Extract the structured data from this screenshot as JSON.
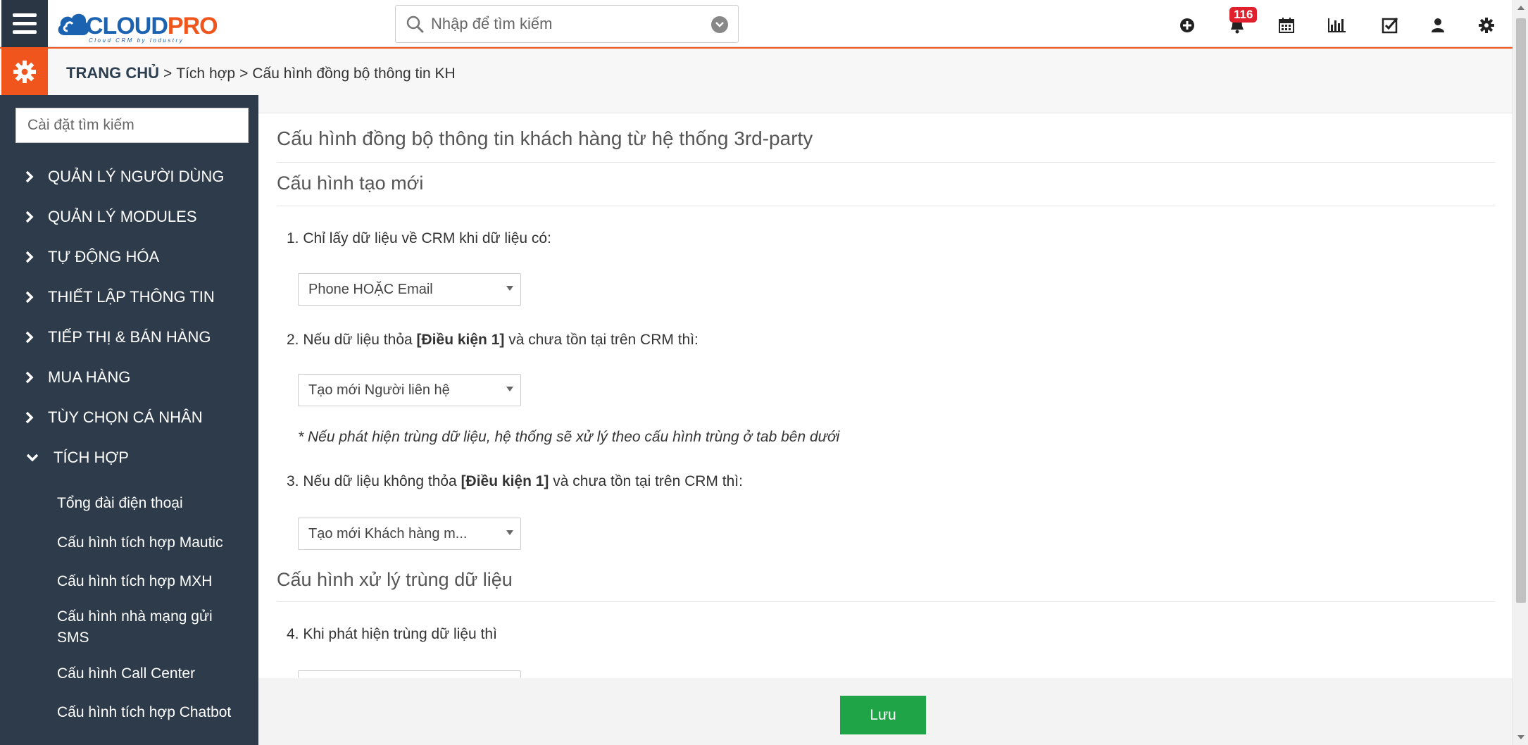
{
  "brand": {
    "logo_left": "CLOUD",
    "logo_right": "PRO",
    "tagline": "Cloud CRM by Industry",
    "accent": "#f0551e",
    "blue": "#1b62b0",
    "sidebar_bg": "#2d3b4a",
    "save_green": "#1fa447"
  },
  "search": {
    "placeholder": "Nhập để tìm kiếm"
  },
  "notifications": {
    "count": "116"
  },
  "top_icons": [
    "plus-circle-icon",
    "bell-icon",
    "calendar-icon",
    "bar-chart-icon",
    "checkbox-icon",
    "user-icon",
    "gear-icon"
  ],
  "breadcrumb": {
    "home": "TRANG CHỦ",
    "sep": ">",
    "level1": "Tích hợp",
    "level2": "Cấu hình đồng bộ thông tin KH"
  },
  "sidebar": {
    "search_placeholder": "Cài đặt tìm kiếm",
    "items": [
      {
        "label": "QUẢN LÝ NGƯỜI DÙNG"
      },
      {
        "label": "QUẢN LÝ MODULES"
      },
      {
        "label": "TỰ ĐỘNG HÓA"
      },
      {
        "label": "THIẾT LẬP THÔNG TIN"
      },
      {
        "label": "TIẾP THỊ & BÁN HÀNG"
      },
      {
        "label": "MUA HÀNG"
      },
      {
        "label": "TÙY CHỌN CÁ NHÂN"
      },
      {
        "label": "TÍCH HỢP"
      }
    ],
    "sub_items": [
      {
        "label": "Tổng đài điện thoại"
      },
      {
        "label": "Cấu hình tích hợp Mautic"
      },
      {
        "label": "Cấu hình tích hợp MXH"
      },
      {
        "label": "Cấu hình nhà mạng gửi SMS"
      },
      {
        "label": "Cấu hình Call Center"
      },
      {
        "label": "Cấu hình tích hợp Chatbot"
      }
    ]
  },
  "main": {
    "title": "Cấu hình đồng bộ thông tin khách hàng từ hệ thống 3rd-party",
    "section1": "Cấu hình tạo mới",
    "q1": "1. Chỉ lấy dữ liệu về CRM khi dữ liệu có:",
    "q1_value": "Phone HOẶC Email",
    "q2_pre": "2. Nếu dữ liệu thỏa ",
    "q2_bold": "[Điều kiện 1]",
    "q2_post": " và chưa tồn tại trên CRM thì:",
    "q2_value": "Tạo mới Người liên hệ",
    "note": "* Nếu phát hiện trùng dữ liệu, hệ thống sẽ xử lý theo cấu hình trùng ở tab bên dưới",
    "q3_pre": "3. Nếu dữ liệu không thỏa ",
    "q3_bold": "[Điều kiện 1]",
    "q3_post": " và chưa tồn tại trên CRM thì:",
    "q3_value": "Tạo mới Khách hàng m...",
    "section2": "Cấu hình xử lý trùng dữ liệu",
    "q4": "4. Khi phát hiện trùng dữ liệu thì"
  },
  "footer": {
    "save_label": "Lưu"
  }
}
